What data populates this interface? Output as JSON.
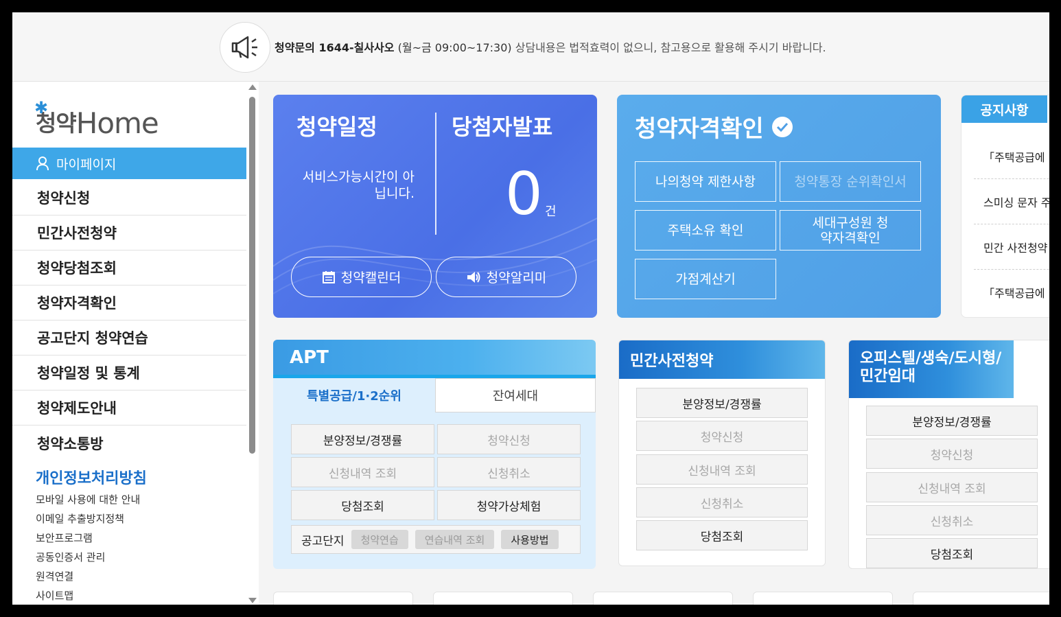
{
  "notice_bar": {
    "strong": "청약문의 1644-칠사사오",
    "hours": " (월~금 09:00~17:30)",
    "rest": " 상담내용은 법적효력이 없으니, 참고용으로 활용해 주시기 바랍니다."
  },
  "sidebar": {
    "logo_ko": "청약",
    "logo_en": "Home",
    "mypage": "마이페이지",
    "menu": [
      "청약신청",
      "민간사전청약",
      "청약당첨조회",
      "청약자격확인",
      "공고단지 청약연습",
      "청약일정 및 통계",
      "청약제도안내",
      "청약소통방"
    ],
    "privacy": "개인정보처리방침",
    "sublinks": [
      "모바일 사용에 대한 안내",
      "이메일 추출방지정책",
      "보안프로그램",
      "공동인증서 관리",
      "원격연결",
      "사이트맵"
    ]
  },
  "schedule_card": {
    "title1": "청약일정",
    "title2": "당첨자발표",
    "message": "서비스가능시간이 아닙니다.",
    "count": "0",
    "unit": "건",
    "calendar_btn": "청약캘린더",
    "alarm_btn": "청약알리미"
  },
  "qual_card": {
    "title": "청약자격확인",
    "buttons": [
      "나의청약 제한사항",
      "청약통장 순위확인서",
      "주택소유 확인",
      "세대구성원 청약자격확인",
      "가점계산기"
    ]
  },
  "notice_card": {
    "tab": "공지사항",
    "items": [
      "「주택공급에",
      "스미싱 문자 주",
      "민간 사전청약",
      "「주택공급에"
    ]
  },
  "apt_box": {
    "title": "APT",
    "tab1": "특별공급/1·2순위",
    "tab2": "잔여세대",
    "buttons": [
      "분양정보/경쟁률",
      "청약신청",
      "신청내역 조회",
      "신청취소",
      "당첨조회",
      "청약가상체험"
    ],
    "complex_label": "공고단지",
    "complex_tags": [
      "청약연습",
      "연습내역 조회",
      "사용방법"
    ]
  },
  "pre_box": {
    "title": "민간사전청약",
    "buttons": [
      "분양정보/경쟁률",
      "청약신청",
      "신청내역 조회",
      "신청취소",
      "당첨조회"
    ]
  },
  "off_box": {
    "title": "오피스텔/생숙/도시형/ 민간임대",
    "buttons": [
      "분양정보/경쟁률",
      "청약신청",
      "신청내역 조회",
      "신청취소",
      "당첨조회"
    ]
  }
}
